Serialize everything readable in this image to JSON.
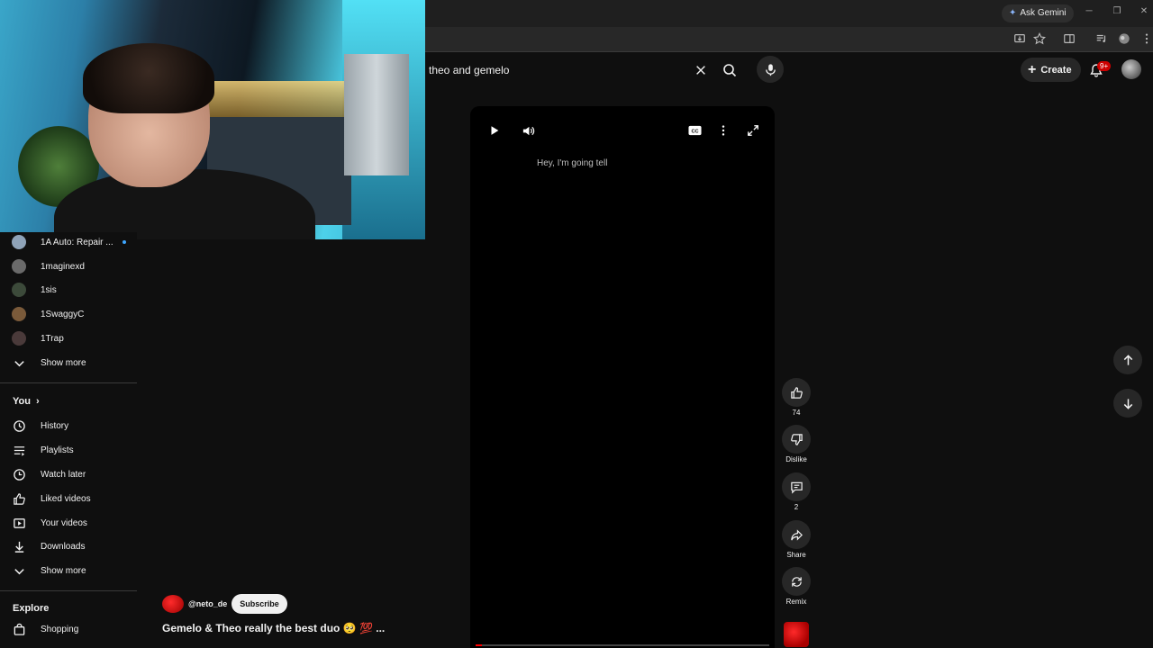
{
  "browser": {
    "gemini_label": "Ask Gemini"
  },
  "header": {
    "search_query": "theo and gemelo",
    "create_label": "Create",
    "notification_count": "9+"
  },
  "sidebar": {
    "subscriptions": [
      {
        "label": "1A Auto: Repair ...",
        "color": "#8fa3b8",
        "new": true
      },
      {
        "label": "1maginexd",
        "color": "#6a6a6a"
      },
      {
        "label": "1sis",
        "color": "#3c4a3a"
      },
      {
        "label": "1SwaggyC",
        "color": "#7a5a3a"
      },
      {
        "label": "1Trap",
        "color": "#4a3a3a"
      }
    ],
    "show_more_1": "Show more",
    "you_heading": "You",
    "you_items": [
      {
        "label": "History",
        "icon": "history-icon"
      },
      {
        "label": "Playlists",
        "icon": "playlists-icon"
      },
      {
        "label": "Watch later",
        "icon": "watch-later-icon"
      },
      {
        "label": "Liked videos",
        "icon": "thumbs-up-icon"
      },
      {
        "label": "Your videos",
        "icon": "your-videos-icon"
      },
      {
        "label": "Downloads",
        "icon": "download-icon"
      }
    ],
    "show_more_2": "Show more",
    "explore_heading": "Explore",
    "explore_items": [
      {
        "label": "Shopping",
        "icon": "shopping-bag-icon"
      }
    ]
  },
  "player": {
    "caption": "Hey, I'm going tell",
    "progress": 0.02
  },
  "actions": {
    "likes": "74",
    "dislike": "Dislike",
    "comments": "2",
    "share": "Share",
    "remix": "Remix"
  },
  "video": {
    "channel": "@neto_de",
    "subscribe": "Subscribe",
    "title": "Gemelo & Theo really the best duo 🥺 💯 ..."
  }
}
